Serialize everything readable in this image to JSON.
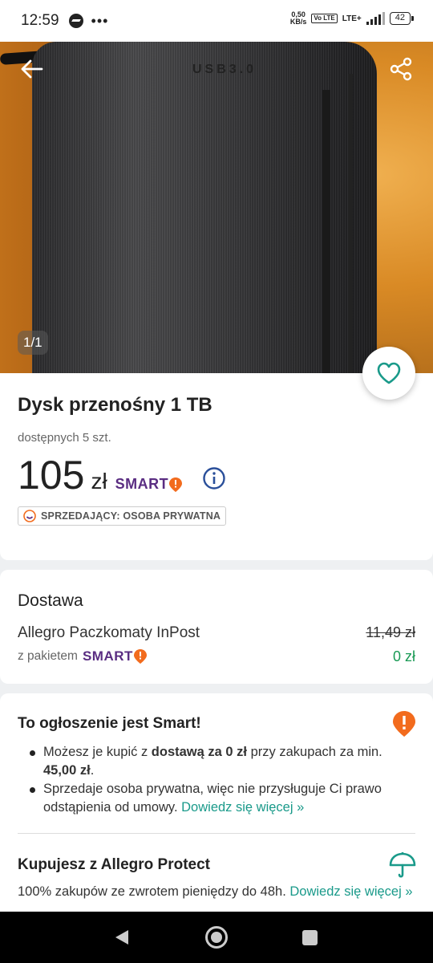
{
  "status_bar": {
    "time": "12:59",
    "more": "•••",
    "speed_value": "0,50",
    "speed_unit": "KB/s",
    "volte": "Vo LTE",
    "network": "LTE+",
    "battery": "42"
  },
  "gallery": {
    "counter": "1/1",
    "image_text": "USB3.0"
  },
  "product": {
    "title": "Dysk przenośny 1 TB",
    "availability": "dostępnych 5 szt.",
    "price": "105",
    "currency": "zł",
    "smart_label": "SMART",
    "seller_badge": "SPRZEDAJĄCY: OSOBA PRYWATNA"
  },
  "delivery": {
    "heading": "Dostawa",
    "method": "Allegro Paczkomaty InPost",
    "old_price": "11,49 zł",
    "package_label": "z pakietem",
    "smart_label": "SMART",
    "new_price": "0 zł"
  },
  "smart_info": {
    "heading": "To ogłoszenie jest Smart!",
    "bullet1_pre": "Możesz je kupić z ",
    "bullet1_bold": "dostawą za 0 zł",
    "bullet1_mid": " przy zakupach za min. ",
    "bullet1_amount": "45,00 zł",
    "bullet1_end": ".",
    "bullet2_text": "Sprzedaje osoba prywatna, więc nie przysługuje Ci prawo odstąpienia od umowy. ",
    "bullet2_link": "Dowiedz się więcej »"
  },
  "protect": {
    "heading": "Kupujesz z Allegro Protect",
    "text": "100% zakupów ze zwrotem pieniędzy do 48h. ",
    "link": "Dowiedz się więcej »"
  },
  "colors": {
    "smart_purple": "#5a2d82",
    "smart_orange": "#f26b1d",
    "link_teal": "#1a9a8a",
    "price_green": "#1a9a55",
    "info_blue": "#2a4f9a"
  }
}
